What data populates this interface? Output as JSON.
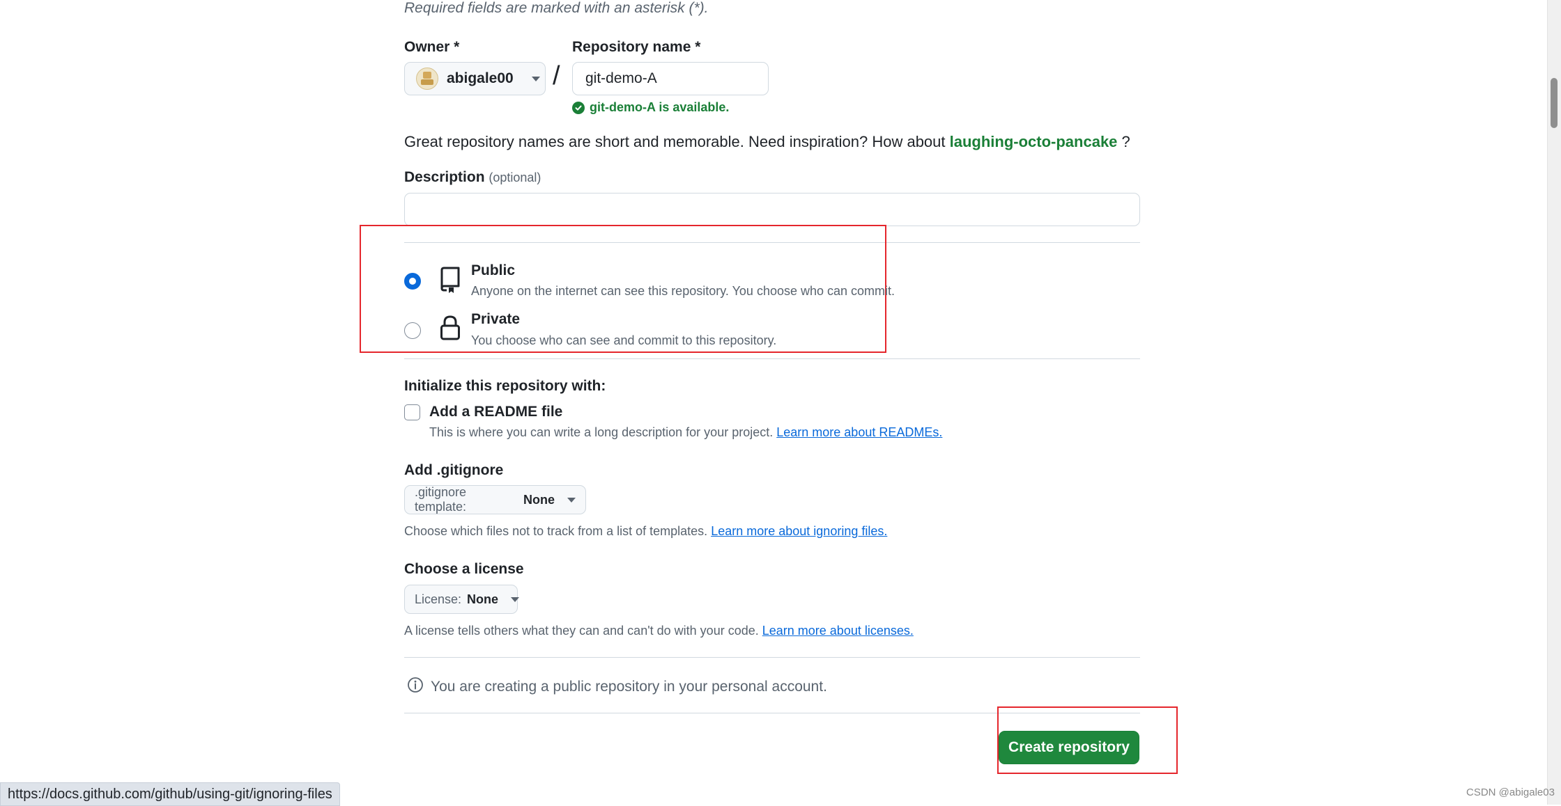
{
  "form": {
    "required_note": "Required fields are marked with an asterisk (*).",
    "owner": {
      "label": "Owner *",
      "value": "abigale00"
    },
    "slash": "/",
    "repo_name": {
      "label": "Repository name *",
      "value": "git-demo-A"
    },
    "availability": "git-demo-A is available.",
    "inspiration": {
      "prefix": "Great repository names are short and memorable. Need inspiration? How about ",
      "suggestion": "laughing-octo-pancake",
      "suffix": " ?"
    },
    "description": {
      "label": "Description",
      "optional": "(optional)",
      "value": ""
    },
    "visibility": {
      "selected": "public",
      "public": {
        "title": "Public",
        "desc": "Anyone on the internet can see this repository. You choose who can commit."
      },
      "private": {
        "title": "Private",
        "desc": "You choose who can see and commit to this repository."
      }
    },
    "initialize": {
      "title": "Initialize this repository with:",
      "readme_label": "Add a README file",
      "readme_checked": false,
      "readme_hint": "This is where you can write a long description for your project.",
      "readme_link": "Learn more about READMEs."
    },
    "gitignore": {
      "title": "Add .gitignore",
      "dropdown_prefix": ".gitignore template:",
      "dropdown_value": "None",
      "hint": "Choose which files not to track from a list of templates.",
      "link": "Learn more about ignoring files."
    },
    "license": {
      "title": "Choose a license",
      "dropdown_prefix": "License:",
      "dropdown_value": "None",
      "hint": "A license tells others what they can and can't do with your code.",
      "link": "Learn more about licenses."
    },
    "info_message": "You are creating a public repository in your personal account.",
    "submit_label": "Create repository"
  },
  "browser": {
    "status_url": "https://docs.github.com/github/using-git/ignoring-files"
  },
  "watermark": "CSDN @abigale03",
  "colors": {
    "primary_button": "#1f883d",
    "link": "#0969da",
    "success": "#1a7f37",
    "highlight_box": "#e5262c"
  }
}
